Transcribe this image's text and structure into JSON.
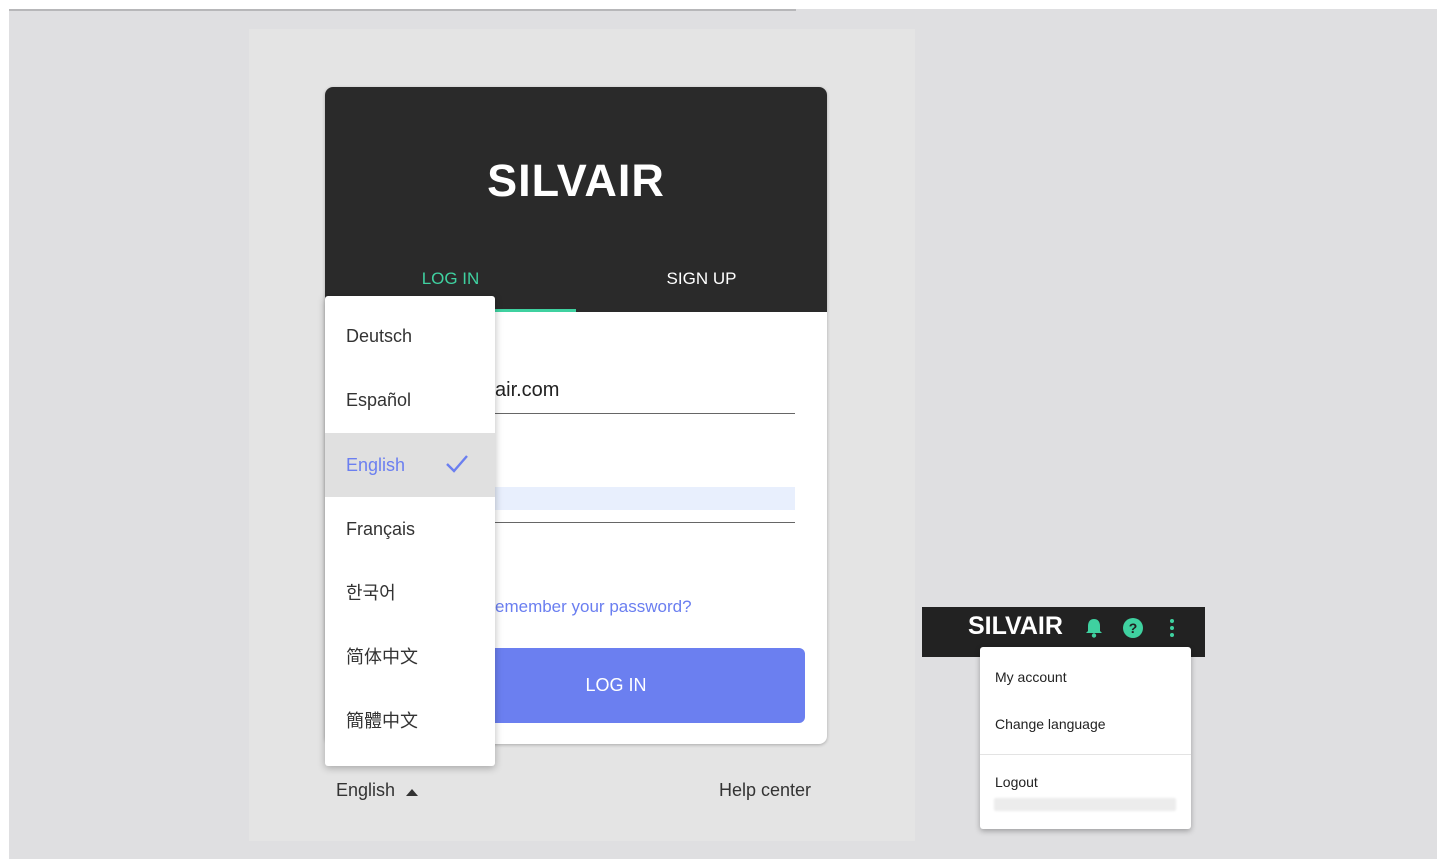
{
  "login_card": {
    "logo": "SILVAIR",
    "tabs": [
      {
        "label": "LOG IN",
        "active": true
      },
      {
        "label": "SIGN UP",
        "active": false
      }
    ],
    "email_value": "air.com",
    "forgot_link": "emember your password?",
    "login_button": "LOG IN"
  },
  "language_menu": {
    "items": [
      "Deutsch",
      "Español",
      "English",
      "Français",
      "한국어",
      "简体中文",
      "簡體中文"
    ],
    "selected": "English"
  },
  "footer": {
    "language": "English",
    "help": "Help center"
  },
  "app_bar": {
    "logo": "SILVAIR",
    "icons": [
      "bell-icon",
      "help-icon",
      "more-vert-icon"
    ]
  },
  "account_menu": {
    "items": [
      "My account",
      "Change language",
      "Logout"
    ]
  },
  "colors": {
    "accent_green": "#3fd1a0",
    "primary_blue": "#6b7ff0",
    "dark_header": "#2a2a2a"
  }
}
